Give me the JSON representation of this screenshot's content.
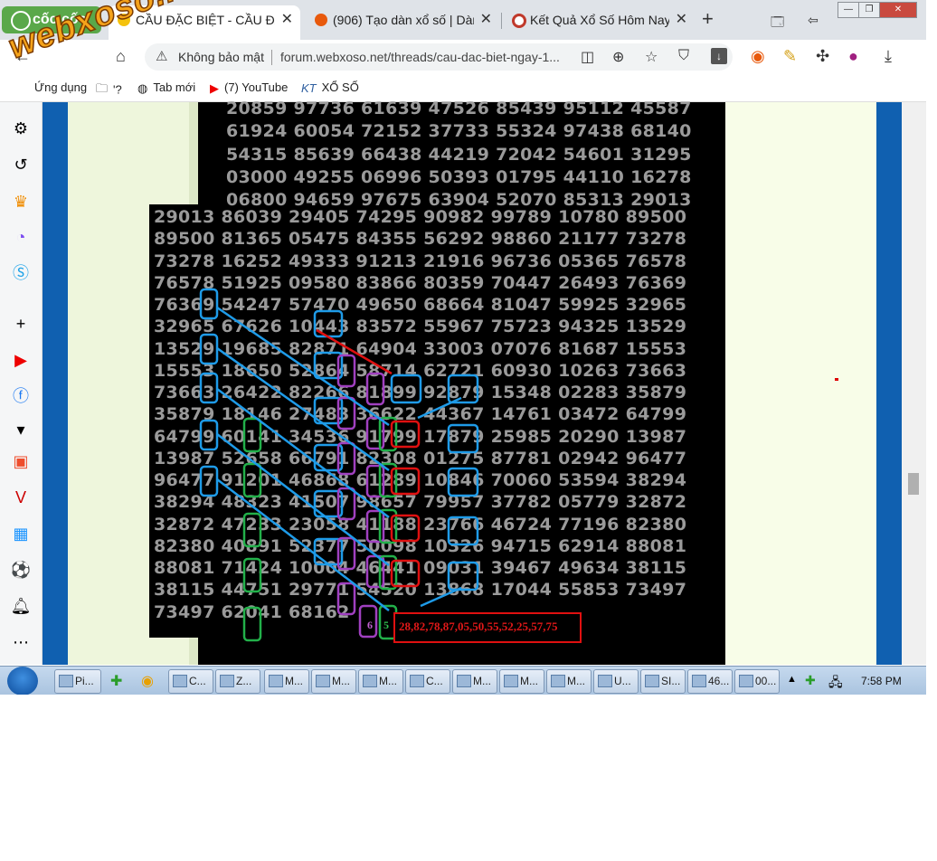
{
  "tabs": {
    "coccoc_label": "cốc cốc",
    "items": [
      {
        "title": "CẦU ĐẶC BIỆT - CẦU ĐẶC BIỆT",
        "close": "✕"
      },
      {
        "title": "(906) Tạo dàn xổ số | Dàn",
        "close": "✕"
      },
      {
        "title": "Kết Quả Xổ Số Hôm Nay",
        "close": "✕"
      }
    ],
    "new_tab": "+"
  },
  "window": {
    "minimize": "—",
    "restore": "❐",
    "close": "✕"
  },
  "address": {
    "security": "Không bảo mật",
    "url": "forum.webxoso.net/threads/cau-dac-biet-ngay-1..."
  },
  "bookmarks": [
    {
      "label": "Ứng dụng",
      "icon": "apps-icon"
    },
    {
      "label": "'?",
      "icon": "folder-icon"
    },
    {
      "label": "Tab mới",
      "icon": "globe-icon"
    },
    {
      "label": "(7) YouTube",
      "icon": "youtube-icon"
    },
    {
      "label": "XỔ SỐ",
      "icon": "kt-icon"
    }
  ],
  "watermark": "webxoso.net",
  "number_rows_top": [
    "20859 97736 61639 47526 85439 95112 45587",
    "61924 60054 72152 37733 55324 97438 68140",
    "54315 85639 66438 44219 72042 54601 31295",
    "03000 49255 06996 50393 01795 44110 16278",
    "06800 94659 97675 63904 52070 85313 29013"
  ],
  "number_rows_main": [
    "29013 86039 29405 74295 90982 99789 10780 89500",
    "89500 81365 05475 84355 56292 98860 21177 73278",
    "73278 16252 49333 91213 21916 96736 05365 76578",
    "76578 51925 09580 83866 80359 70447 26493 76369",
    "76369 54247 57470 49650 68664 81047 59925 32965",
    "32965 67626 10443 83572 55967 75723 94325 13529",
    "13529 19685 82871 64904 33003 07076 81687 15553",
    "15553 18650 52864 58714 62721 60930 10263 73663",
    "73663 26422 82266 81899 92879 15348 02283 35879",
    "35879 18146 27483 36622 44367 14761 03472 64799",
    "64799 60141 34536 91799 17879 25985 20290 13987",
    "13987 52658 66791 82308 01275 87781 02942 96477",
    "96477 91201 46868 61289 10846 70060 53594 38294",
    "38294 48323 41507 98657 79957 37782 05779 32872",
    "32872 47233 23058 41188 23766 46724 77196 82380",
    "82380 40891 52377 50098 10326 94715 62914 88081",
    "88081 71424 10004 46441 09031 39467 49634 38115",
    "38115 44751 29771 54520 13868 17044 55853 73497",
    "73497 62041 68162"
  ],
  "result": {
    "digit_purple": "6",
    "digit_green": "5",
    "numbers": "28,82,78,87,05,50,55,52,25,57,75"
  },
  "taskbar": {
    "items": [
      "Pi...",
      "C...",
      "Z...",
      "M...",
      "M...",
      "M...",
      "C...",
      "M...",
      "M...",
      "M...",
      "U...",
      "SI...",
      "46...",
      "00..."
    ],
    "time": "7:58 PM"
  },
  "colors": {
    "blue_box": "#1e9be8",
    "red_box": "#e01010",
    "green_box": "#22b04a",
    "purple_box": "#a040c0",
    "number_gray": "#9a9a9a"
  }
}
